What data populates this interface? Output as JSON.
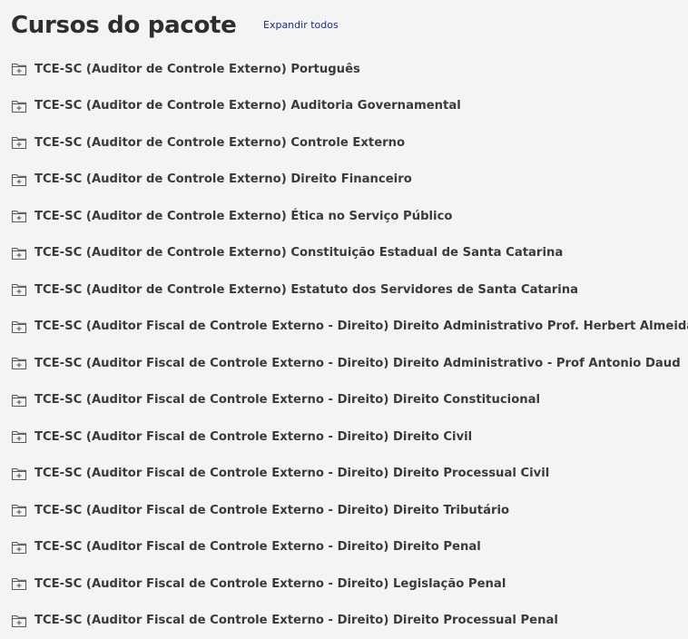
{
  "header": {
    "title": "Cursos do pacote",
    "expand_label": "Expandir todos"
  },
  "icons": {
    "course_folder": "folder-plus-icon"
  },
  "colors": {
    "background": "#f4f4f4",
    "link": "#1f2a7a",
    "text": "#3a3a3a"
  },
  "courses": [
    {
      "label": "TCE-SC (Auditor de Controle Externo) Português"
    },
    {
      "label": "TCE-SC (Auditor de Controle Externo) Auditoria Governamental"
    },
    {
      "label": "TCE-SC (Auditor de Controle Externo) Controle Externo"
    },
    {
      "label": "TCE-SC (Auditor de Controle Externo) Direito Financeiro"
    },
    {
      "label": "TCE-SC (Auditor de Controle Externo) Ética no Serviço Público"
    },
    {
      "label": "TCE-SC (Auditor de Controle Externo) Constituição Estadual de Santa Catarina"
    },
    {
      "label": "TCE-SC (Auditor de Controle Externo) Estatuto dos Servidores de Santa Catarina"
    },
    {
      "label": "TCE-SC (Auditor Fiscal de Controle Externo - Direito) Direito Administrativo Prof. Herbert Almeida"
    },
    {
      "label": "TCE-SC (Auditor Fiscal de Controle Externo - Direito) Direito Administrativo - Prof Antonio Daud"
    },
    {
      "label": "TCE-SC (Auditor Fiscal de Controle Externo - Direito) Direito Constitucional"
    },
    {
      "label": "TCE-SC (Auditor Fiscal de Controle Externo - Direito) Direito Civil"
    },
    {
      "label": "TCE-SC (Auditor Fiscal de Controle Externo - Direito) Direito Processual Civil"
    },
    {
      "label": "TCE-SC (Auditor Fiscal de Controle Externo - Direito) Direito Tributário"
    },
    {
      "label": "TCE-SC (Auditor Fiscal de Controle Externo - Direito) Direito Penal"
    },
    {
      "label": "TCE-SC (Auditor Fiscal de Controle Externo - Direito) Legislação Penal"
    },
    {
      "label": "TCE-SC (Auditor Fiscal de Controle Externo - Direito) Direito Processual Penal"
    }
  ]
}
